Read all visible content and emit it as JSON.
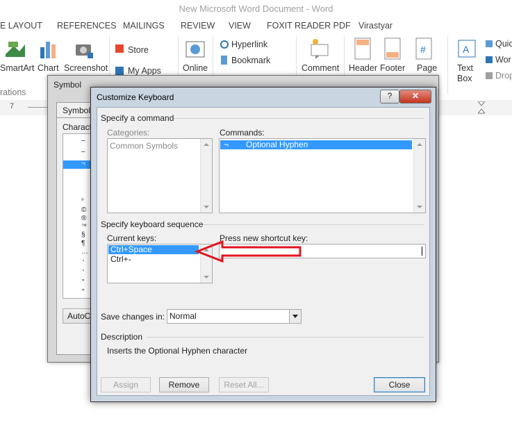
{
  "window": {
    "title": "New Microsoft Word Document - Word"
  },
  "tabs": [
    "E LAYOUT",
    "REFERENCES",
    "MAILINGS",
    "REVIEW",
    "VIEW",
    "FOXIT READER PDF",
    "Virastyar"
  ],
  "ribbon": {
    "smartart": "SmartArt",
    "chart": "Chart",
    "screenshot": "Screenshot",
    "illustrations_group": "rations",
    "store": "Store",
    "my_apps": "My Apps",
    "online": "Online",
    "hyperlink": "Hyperlink",
    "bookmark": "Bookmark",
    "comment": "Comment",
    "header": "Header",
    "footer": "Footer",
    "page": "Page",
    "text_box": "Text Box",
    "quick": "Quic",
    "word": "Wor",
    "drop": "Drop"
  },
  "ruler": {
    "mark": "7"
  },
  "symbol_dialog": {
    "title": "Symbol",
    "tab_symbols": "Symbols",
    "characters_label": "Charact",
    "autocorrect": "AutoC",
    "chars": [
      "–",
      "–",
      "¬",
      "°",
      "©",
      "®",
      "™",
      "§",
      "¶",
      "…",
      "'",
      "'",
      "\"",
      "\""
    ]
  },
  "customize_dialog": {
    "title": "Customize Keyboard",
    "help": "?",
    "close_x": "✕",
    "specify_command": "Specify a command",
    "categories_label": "Categories:",
    "categories": [
      "Common Symbols"
    ],
    "commands_label": "Commands:",
    "commands": [
      {
        "symbol": "¬",
        "name": "Optional Hyphen"
      }
    ],
    "specify_sequence": "Specify keyboard sequence",
    "current_keys_label": "Current keys:",
    "current_keys": [
      "Ctrl+Space",
      "Ctrl+-"
    ],
    "press_new_label": "Press new shortcut key:",
    "press_new_value": "",
    "save_in_label": "Save changes in:",
    "save_in_value": "Normal",
    "description_label": "Description",
    "description_text": "Inserts the Optional Hyphen character",
    "assign": "Assign",
    "remove": "Remove",
    "reset_all": "Reset All...",
    "close": "Close"
  },
  "colors": {
    "selection": "#3399ff",
    "annotation_arrow": "#e0141e"
  }
}
